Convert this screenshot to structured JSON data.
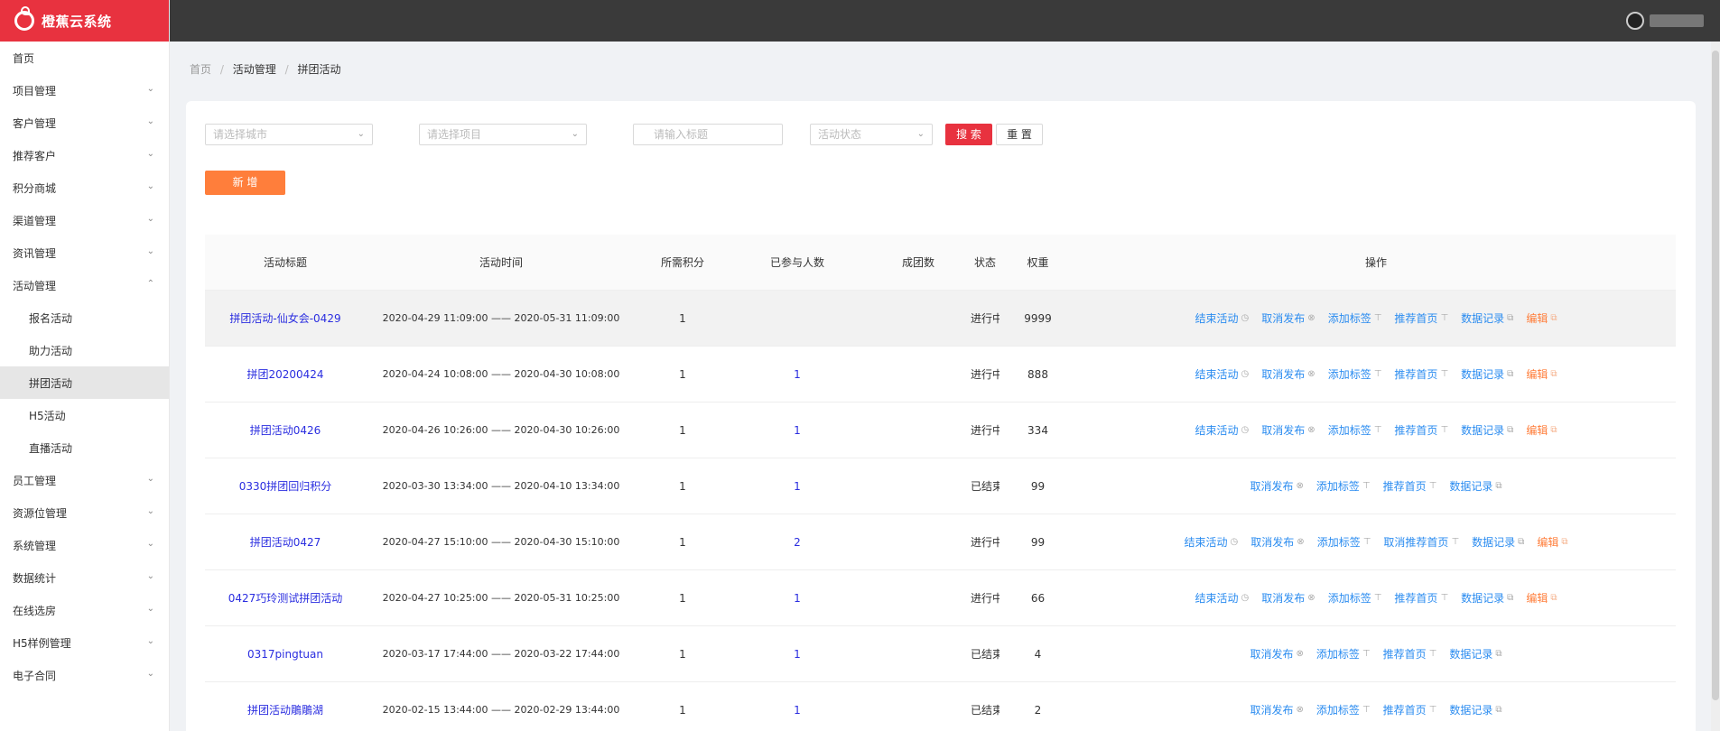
{
  "app": {
    "title": "橙蕉云系统"
  },
  "menu": [
    {
      "label": "首页",
      "chev": false
    },
    {
      "label": "项目管理",
      "chev": true
    },
    {
      "label": "客户管理",
      "chev": true
    },
    {
      "label": "推荐客户",
      "chev": true
    },
    {
      "label": "积分商城",
      "chev": true
    },
    {
      "label": "渠道管理",
      "chev": true
    },
    {
      "label": "资讯管理",
      "chev": true
    },
    {
      "label": "活动管理",
      "chev": true,
      "open": true,
      "children": [
        "报名活动",
        "助力活动",
        "拼团活动",
        "H5活动",
        "直播活动"
      ],
      "active_child": 2
    },
    {
      "label": "员工管理",
      "chev": true
    },
    {
      "label": "资源位管理",
      "chev": true
    },
    {
      "label": "系统管理",
      "chev": true
    },
    {
      "label": "数据统计",
      "chev": true
    },
    {
      "label": "在线选房",
      "chev": true
    },
    {
      "label": "H5样例管理",
      "chev": true
    },
    {
      "label": "电子合同",
      "chev": true
    }
  ],
  "breadcrumb": [
    "首页",
    "活动管理",
    "拼团活动"
  ],
  "filters": {
    "city_placeholder": "请选择城市",
    "project_placeholder": "请选择项目",
    "title_placeholder": "请输入标题",
    "status_placeholder": "活动状态",
    "search_label": "搜 索",
    "reset_label": "重 置"
  },
  "add_label": "新 增",
  "table": {
    "headers": [
      "活动标题",
      "活动时间",
      "所需积分",
      "已参与人数",
      "成团数",
      "状态",
      "权重",
      "操作"
    ],
    "rows": [
      {
        "title": "拼团活动-仙女会-0429",
        "time": "2020-04-29 11:09:00 —— 2020-05-31 11:09:00",
        "points": "1",
        "joined": "",
        "groups": "",
        "status": "进行中",
        "weight": "9999",
        "ops": [
          "结束活动",
          "取消发布",
          "添加标签",
          "推荐首页",
          "数据记录",
          "编辑"
        ],
        "highlight": true
      },
      {
        "title": "拼团20200424",
        "time": "2020-04-24 10:08:00 —— 2020-04-30 10:08:00",
        "points": "1",
        "joined": "1",
        "groups": "",
        "status": "进行中",
        "weight": "888",
        "ops": [
          "结束活动",
          "取消发布",
          "添加标签",
          "推荐首页",
          "数据记录",
          "编辑"
        ]
      },
      {
        "title": "拼团活动0426",
        "time": "2020-04-26 10:26:00 —— 2020-04-30 10:26:00",
        "points": "1",
        "joined": "1",
        "groups": "",
        "status": "进行中",
        "weight": "334",
        "ops": [
          "结束活动",
          "取消发布",
          "添加标签",
          "推荐首页",
          "数据记录",
          "编辑"
        ]
      },
      {
        "title": "0330拼团回归积分",
        "time": "2020-03-30 13:34:00 —— 2020-04-10 13:34:00",
        "points": "1",
        "joined": "1",
        "groups": "",
        "status": "已结束",
        "weight": "99",
        "ops": [
          "取消发布",
          "添加标签",
          "推荐首页",
          "数据记录"
        ]
      },
      {
        "title": "拼团活动0427",
        "time": "2020-04-27 15:10:00 —— 2020-04-30 15:10:00",
        "points": "1",
        "joined": "2",
        "groups": "",
        "status": "进行中",
        "weight": "99",
        "ops": [
          "结束活动",
          "取消发布",
          "添加标签",
          "取消推荐首页",
          "数据记录",
          "编辑"
        ]
      },
      {
        "title": "0427巧玲测试拼团活动",
        "time": "2020-04-27 10:25:00 —— 2020-05-31 10:25:00",
        "points": "1",
        "joined": "1",
        "groups": "",
        "status": "进行中",
        "weight": "66",
        "ops": [
          "结束活动",
          "取消发布",
          "添加标签",
          "推荐首页",
          "数据记录",
          "编辑"
        ]
      },
      {
        "title": "0317pingtuan",
        "time": "2020-03-17 17:44:00 —— 2020-03-22 17:44:00",
        "points": "1",
        "joined": "1",
        "groups": "",
        "status": "已结束",
        "weight": "4",
        "ops": [
          "取消发布",
          "添加标签",
          "推荐首页",
          "数据记录"
        ]
      },
      {
        "title": "拼团活动鵰鵰湖",
        "time": "2020-02-15 13:44:00 —— 2020-02-29 13:44:00",
        "points": "1",
        "joined": "1",
        "groups": "",
        "status": "已结束",
        "weight": "2",
        "ops": [
          "取消发布",
          "添加标签",
          "推荐首页",
          "数据记录"
        ]
      }
    ]
  },
  "colors": {
    "brand": "#e8323f",
    "link": "#2b8cf0",
    "edit": "#ff7e3b",
    "title_link": "#2b2ee0"
  }
}
